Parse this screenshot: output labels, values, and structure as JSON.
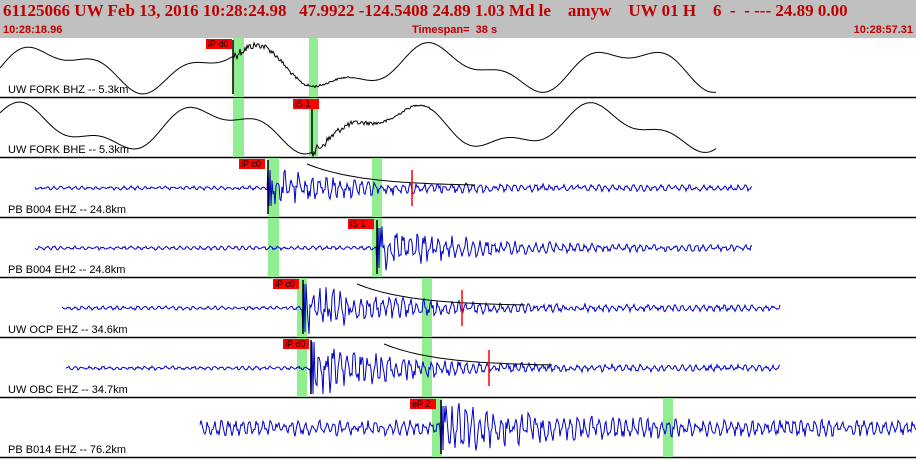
{
  "header": {
    "title": "61125066 UW Feb 13, 2016 10:28:24.98   47.9922 -124.5408 24.89 1.03 Md le    amyw    UW 01 H    6  -  - --- 24.89 0.00",
    "start_time": "10:28:18.96",
    "timespan": "Timespan=  38 s",
    "end_time": "10:28:57.31"
  },
  "colors": {
    "header_bg": "#c0c0c0",
    "header_text": "#c00000",
    "pick_marker": "#ff0000",
    "window_band": "#90ee90",
    "waveform_black": "#000000",
    "waveform_blue": "#0000cc",
    "coda_fit": "#000000"
  },
  "channels": [
    {
      "label": "UW FORK BHZ -- 5.3km",
      "trace_color": "black",
      "pick": "iP d0"
    },
    {
      "label": "UW FORK BHE -- 5.3km",
      "trace_color": "black",
      "pick": "iS 1"
    },
    {
      "label": "PB B004 EHZ -- 24.8km",
      "trace_color": "blue",
      "pick": "iP c0"
    },
    {
      "label": "PB B004 EH2 -- 24.8km",
      "trace_color": "blue",
      "pick": "iS 1"
    },
    {
      "label": "UW OCP EHZ -- 34.6km",
      "trace_color": "blue",
      "pick": "iP c0"
    },
    {
      "label": "UW OBC EHZ -- 34.7km",
      "trace_color": "blue",
      "pick": "iP d0"
    },
    {
      "label": "PB B014 EHZ -- 76.2km",
      "trace_color": "blue",
      "pick": "eP 2"
    }
  ]
}
